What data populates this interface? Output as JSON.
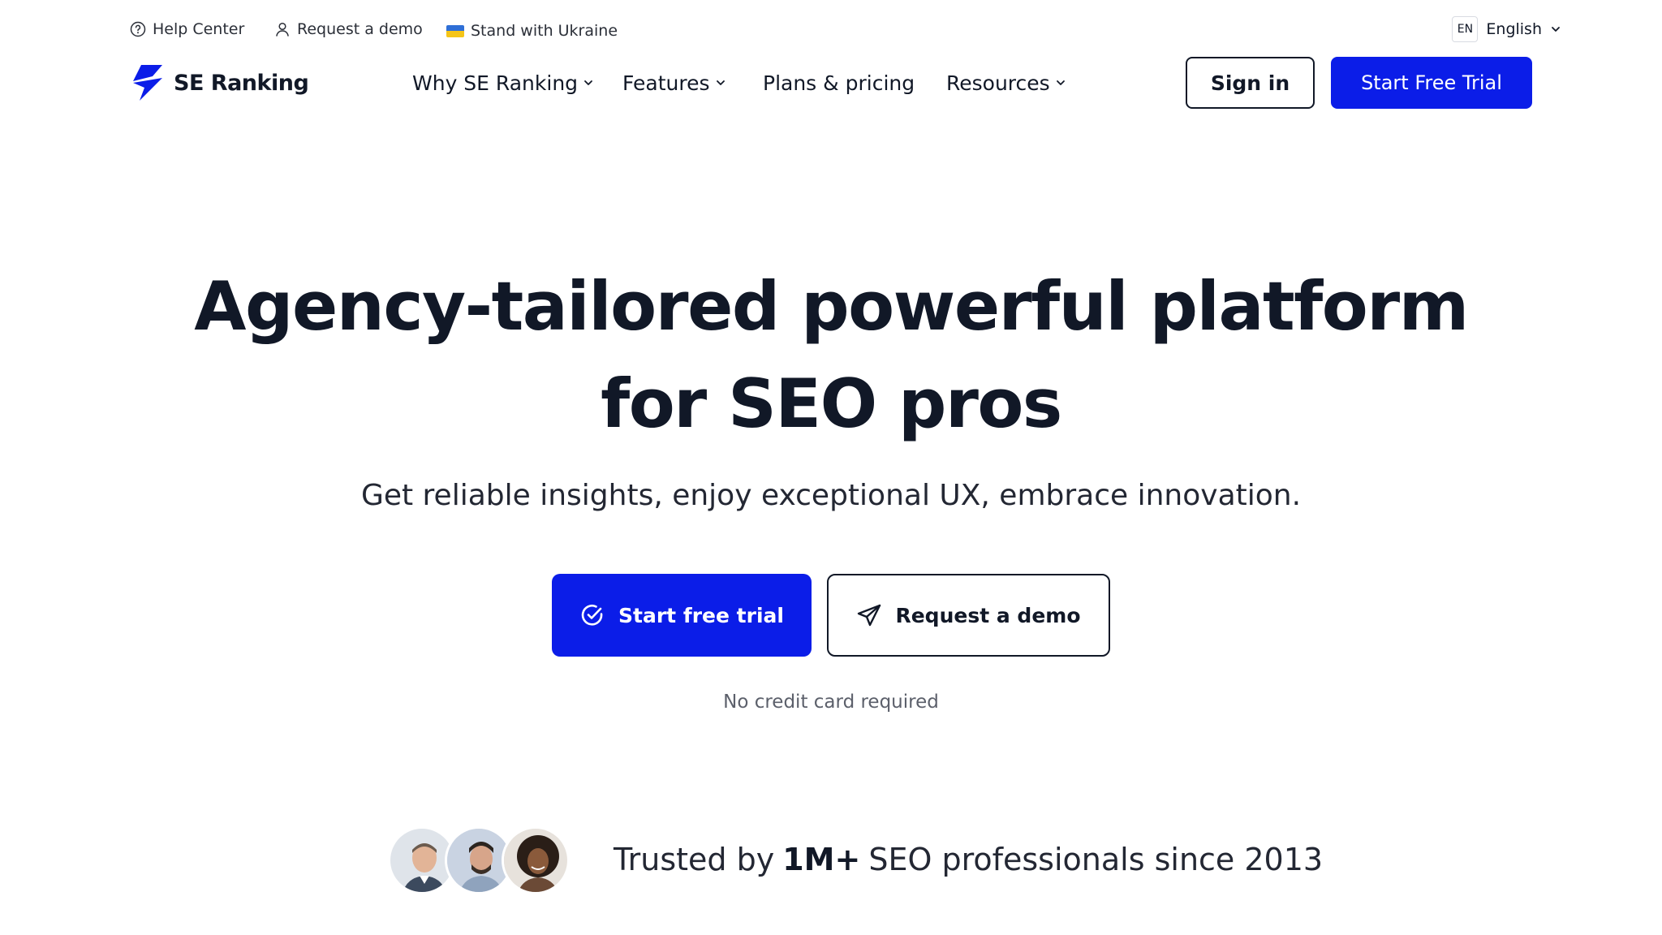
{
  "utility_bar": {
    "help_center": "Help Center",
    "request_demo": "Request a demo",
    "ukraine": "Stand with Ukraine",
    "language_code": "EN",
    "language_name": "English"
  },
  "header": {
    "logo_text": "SE Ranking",
    "nav": [
      {
        "label": "Why SE Ranking",
        "has_dropdown": true
      },
      {
        "label": "Features",
        "has_dropdown": true
      },
      {
        "label": "Plans & pricing",
        "has_dropdown": false
      },
      {
        "label": "Resources",
        "has_dropdown": true
      }
    ],
    "sign_in": "Sign in",
    "start_trial": "Start Free Trial"
  },
  "hero": {
    "title_line1": "Agency-tailored powerful platform",
    "title_line2": "for SEO pros",
    "subtitle": "Get reliable insights, enjoy exceptional UX, embrace innovation.",
    "primary_cta": "Start free trial",
    "secondary_cta": "Request a demo",
    "note": "No credit card required"
  },
  "trust": {
    "prefix": "Trusted by",
    "highlight": "1M+",
    "suffix": "SEO professionals since 2013"
  },
  "colors": {
    "brand_blue": "#0b1de8",
    "text_dark": "#111827"
  }
}
